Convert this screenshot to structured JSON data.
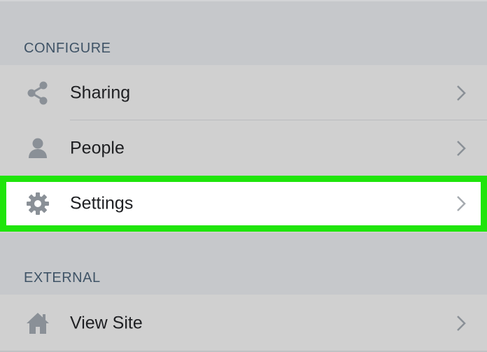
{
  "sections": {
    "configure": {
      "title": "CONFIGURE",
      "items": [
        {
          "label": "Sharing",
          "icon": "share-icon"
        },
        {
          "label": "People",
          "icon": "person-icon"
        },
        {
          "label": "Settings",
          "icon": "gear-icon",
          "highlighted": true
        }
      ]
    },
    "external": {
      "title": "EXTERNAL",
      "items": [
        {
          "label": "View Site",
          "icon": "home-icon"
        }
      ]
    }
  },
  "colors": {
    "background": "#c6c8cb",
    "row_background": "#d0d0d0",
    "highlight_border": "#1fe50b",
    "highlight_background": "#ffffff",
    "icon": "#8a9097",
    "header_text": "#3f5366"
  }
}
